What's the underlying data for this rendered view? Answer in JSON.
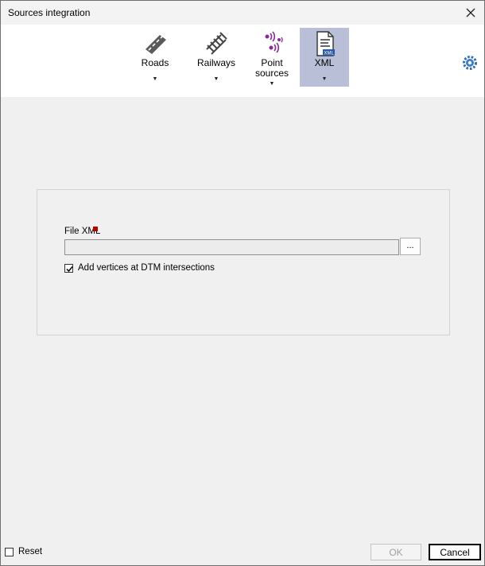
{
  "window": {
    "title": "Sources integration"
  },
  "ribbon": {
    "buttons": [
      {
        "label": "Roads",
        "icon": "road-icon"
      },
      {
        "label": "Railways",
        "icon": "railway-icon"
      },
      {
        "label": "Point sources",
        "icon": "point-source-icon"
      },
      {
        "label": "XML",
        "icon": "xml-file-icon",
        "active": true
      }
    ]
  },
  "form": {
    "file_label": "File XML",
    "file_value": "",
    "browse_label": "...",
    "vertices_checkbox_label": "Add vertices at DTM intersections",
    "vertices_checked": true
  },
  "footer": {
    "reset_label": "Reset",
    "reset_checked": false,
    "ok_label": "OK",
    "ok_enabled": false,
    "cancel_label": "Cancel"
  },
  "colors": {
    "active_tab_bg": "#b8bfd7",
    "required_marker": "#c00000",
    "point_source_icon": "#8a2a9a"
  }
}
